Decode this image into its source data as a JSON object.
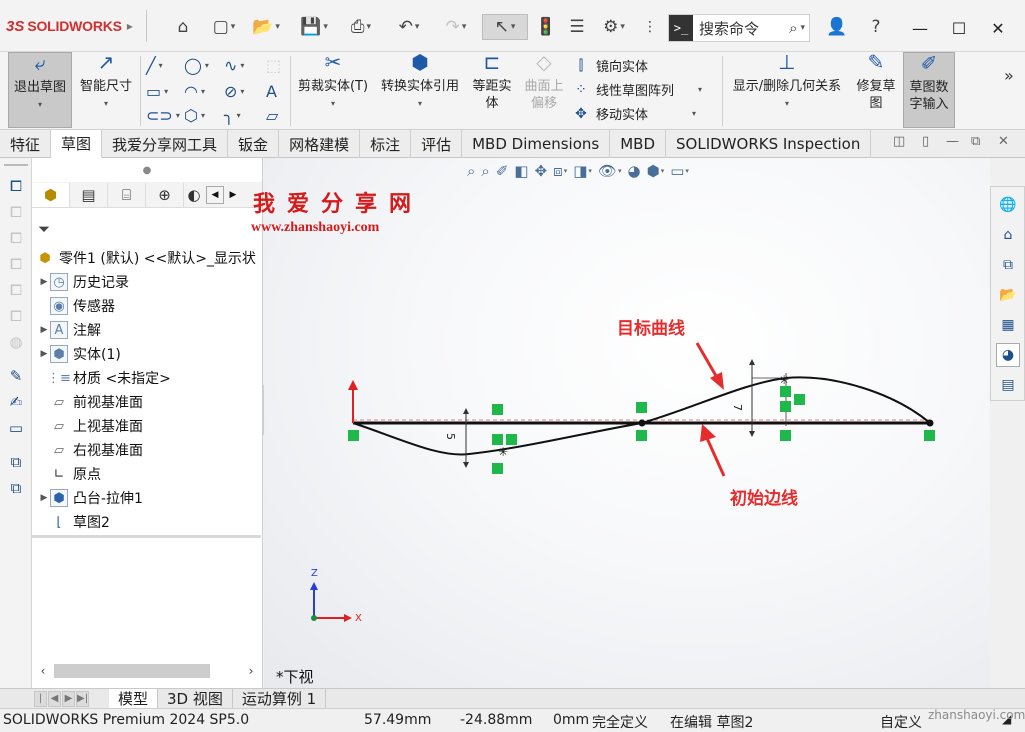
{
  "app": {
    "logo_ds": "3S",
    "logo_name": "SOLIDWORKS"
  },
  "search": {
    "placeholder": "搜索命令",
    "cmd_glyph": ">_"
  },
  "command_bar": {
    "exit_sketch": "退出草图",
    "smart_dimension": "智能尺寸",
    "trim_entities": "剪裁实体(T)",
    "convert_entities": "转换实体引用",
    "offset_entities_l1": "等距实",
    "offset_entities_l2": "体",
    "offset_surface_l1": "曲面上",
    "offset_surface_l2": "偏移",
    "mirror_entities": "镜向实体",
    "linear_pattern": "线性草图阵列",
    "move_entities": "移动实体",
    "display_relations": "显示/删除几何关系",
    "repair_sketch_l1": "修复草",
    "repair_sketch_l2": "图",
    "sketch_numeric_l1": "草图数",
    "sketch_numeric_l2": "字输入"
  },
  "tabs": [
    "特征",
    "草图",
    "我爱分享网工具",
    "钣金",
    "网格建模",
    "标注",
    "评估",
    "MBD Dimensions",
    "MBD",
    "SOLIDWORKS Inspection"
  ],
  "active_tab": "草图",
  "feature_tree": {
    "root": "零件1 (默认) <<默认>_显示状",
    "items": [
      {
        "label": "历史记录",
        "expandable": true
      },
      {
        "label": "传感器",
        "expandable": false
      },
      {
        "label": "注解",
        "expandable": true
      },
      {
        "label": "实体(1)",
        "expandable": true
      },
      {
        "label": "材质 <未指定>",
        "expandable": false
      },
      {
        "label": "前视基准面",
        "expandable": false
      },
      {
        "label": "上视基准面",
        "expandable": false
      },
      {
        "label": "右视基准面",
        "expandable": false
      },
      {
        "label": "原点",
        "expandable": false
      },
      {
        "label": "凸台-拉伸1",
        "expandable": true
      },
      {
        "label": "草图2",
        "expandable": false
      }
    ]
  },
  "watermark": {
    "title": "我爱分享网",
    "url": "www.zhanshaoyi.com"
  },
  "annotations": {
    "target_curve": "目标曲线",
    "initial_edge": "初始边线"
  },
  "dims": {
    "d1": "5",
    "d2": "7"
  },
  "view_name": "*下视",
  "triad": {
    "z": "Z",
    "x": "X"
  },
  "bottom_tabs": [
    "模型",
    "3D 视图",
    "运动算例 1"
  ],
  "active_bottom_tab": "模型",
  "status": {
    "product": "SOLIDWORKS Premium 2024 SP5.0",
    "x": "57.49mm",
    "y": "-24.88mm",
    "z": "0mm",
    "state": "完全定义",
    "editing": "在编辑 草图2",
    "units": "自定义",
    "watermark": "zhanshaoyi.com"
  }
}
